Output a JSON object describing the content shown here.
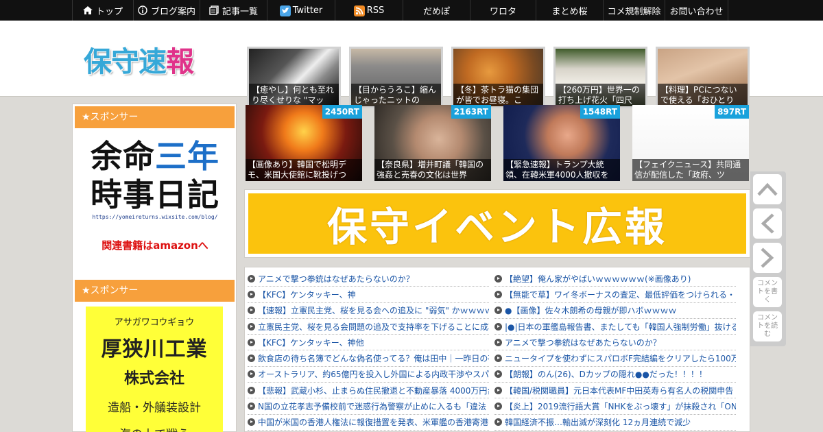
{
  "nav": {
    "items": [
      {
        "label": "トップ",
        "icon": "home-icon"
      },
      {
        "label": "ブログ案内",
        "icon": "info-icon"
      },
      {
        "label": "記事一覧",
        "icon": "list-icon"
      },
      {
        "label": "Twitter",
        "icon": "twitter-icon"
      },
      {
        "label": "RSS",
        "icon": "rss-icon"
      },
      {
        "label": "だめぽ",
        "icon": ""
      },
      {
        "label": "ワロタ",
        "icon": ""
      },
      {
        "label": "まとめ桜",
        "icon": ""
      },
      {
        "label": "コメ規制解除",
        "icon": ""
      },
      {
        "label": "お問い合わせ",
        "icon": ""
      }
    ]
  },
  "header": {
    "logo_chars": [
      "保",
      "守",
      "速",
      "報"
    ],
    "logo_colors": [
      "#36a8d8",
      "#36a8d8",
      "#36a8d8",
      "#e0338a"
    ],
    "thumbs": [
      {
        "caption": "【癒やし】何とも至れり尽くせりな \"マッ"
      },
      {
        "caption": "【目からうろこ】縮んじゃったニットの"
      },
      {
        "caption": "【冬】茶トラ猫の集団が皆でお昼寝。こ"
      },
      {
        "caption": "【260万円】世界一の打ち上げ花火「四尺"
      },
      {
        "caption": "【料理】PCにつないで使える「おひとり"
      }
    ]
  },
  "sidebar": {
    "sponsor1": "★スポンサー",
    "sponsor2": "★スポンサー",
    "ad1": {
      "line1a": "余命",
      "line1b": "三年",
      "line2": "時事日記",
      "url": "https://yomeireturns.wixsite.com/blog/",
      "link": "関連書籍はamazonへ"
    },
    "ad2": {
      "kana": "アサガワコウギョウ",
      "name": "厚狭川工業",
      "company": "株式会社",
      "desc": "造船・外艤装設計",
      "more": "海の上で戦う"
    }
  },
  "rt": [
    {
      "badge": "2450RT",
      "caption": "【画像あり】韓国で松明デモ、米国大使館に靴投げつ"
    },
    {
      "badge": "2163RT",
      "caption": "【奈良県】増井町議「韓国の強姦と売春の文化は世界"
    },
    {
      "badge": "1548RT",
      "caption": "【緊急速報】トランプ大統領、在韓米軍4000人撤収を"
    },
    {
      "badge": "897RT",
      "caption": "【フェイクニュース】共同通信が配信した「政府、ツ"
    }
  ],
  "banner": {
    "text": "保守イベント広報"
  },
  "list_left": [
    "アニメで撃つ拳銃はなぜあたらないのか？",
    "【KFC】ケンタッキー、神",
    "【速報】立憲民主党、桜を見る会への追及に \"弱気\" かｗｗｗｗ",
    "立憲民主党、桜を見る会問題の追及で支持率を下げることに成功",
    "【KFC】ケンタッキー、神他",
    "飲食店の待ち名簿でどんな偽名使ってる？俺は田中｜一昨日の夜",
    "オーストラリア、約65億円を投入し外国による内政干渉やスパイ",
    "【悲報】武蔵小杉、止まらぬ住民撤退と不動産暴落 4000万円台",
    "N国の立花孝志予備校前で迷惑行為警察が止めに入るも「違法",
    "中国が米国の香港人権法に報復措置を発表、米軍艦の香港寄港"
  ],
  "list_right": [
    "【絶望】俺ん家がやばいｗｗｗｗｗｗ(※画像あり)",
    "【無能で草】ワイ冬ボーナスの査定、最低評価をつけられる・",
    "●【画像】佐々木朗希の母親が即ハボｗｗｗｗ",
    "|●|日本の軍艦島報告書、またしても「韓国人強制労働」抜ける",
    "アニメで撃つ拳銃はなぜあたらないのか？",
    "ニュータイプを使わずにスパロボF完結編をクリアしたら100万",
    "【朗報】のん(26)、Dカップの隠れ●●だった！！！！",
    "【韓国/税関職員】元日本代表MF中田英寿ら有名人の税関申告",
    "【炎上】2019流行語大賞「NHKをぶっ壊す」が抹殺され「ON",
    "韓国経済不振…輸出減が深刻化 12ヵ月連続で減少"
  ],
  "side_buttons": {
    "top": "up-chevron-icon",
    "back": "left-chevron-icon",
    "forward": "right-chevron-icon",
    "write": "コメントを書く",
    "read": "コメントを読む"
  }
}
